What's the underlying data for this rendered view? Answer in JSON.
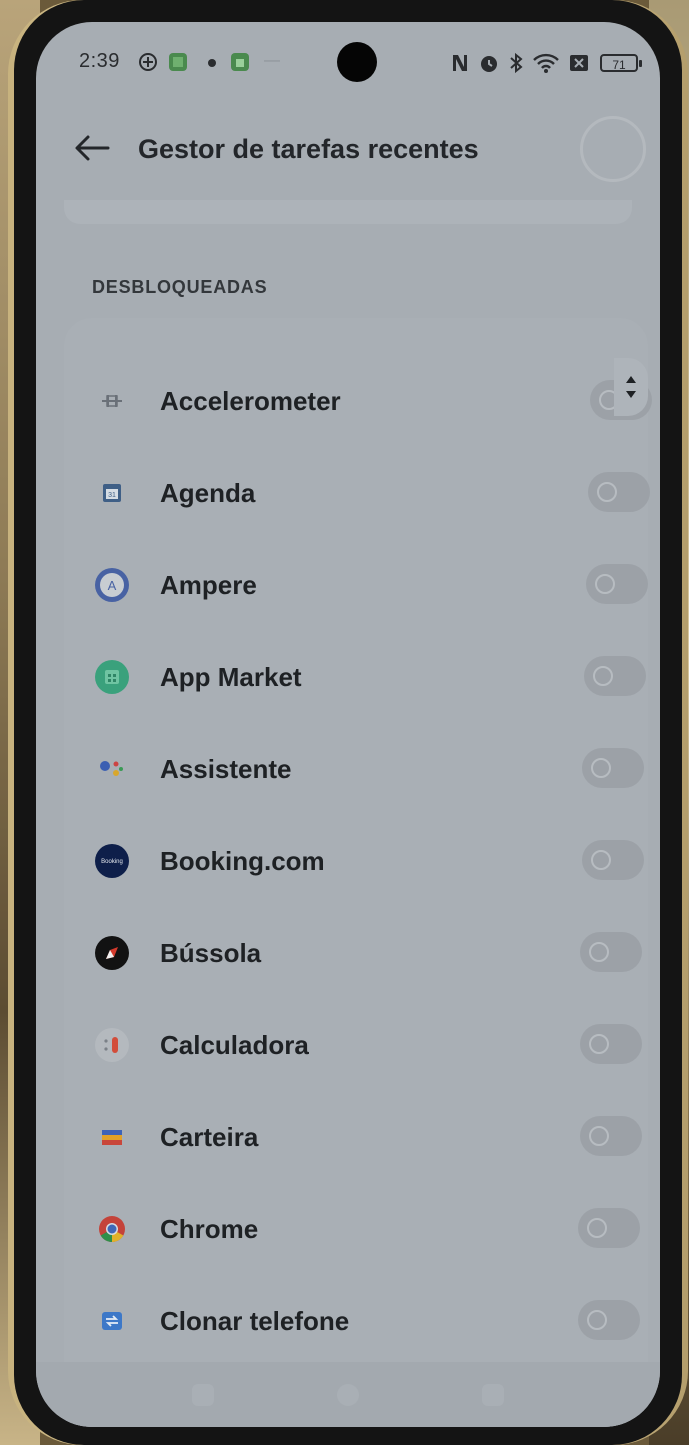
{
  "status_bar": {
    "time": "2:39",
    "battery": "71"
  },
  "header": {
    "title": "Gestor de tarefas recentes"
  },
  "section": {
    "label": "DESBLOQUEADAS"
  },
  "apps": [
    {
      "label": "Accelerometer",
      "icon": "accelerometer-icon",
      "enabled": false
    },
    {
      "label": "Agenda",
      "icon": "calendar-icon",
      "enabled": false
    },
    {
      "label": "Ampere",
      "icon": "ampere-icon",
      "enabled": false
    },
    {
      "label": "App Market",
      "icon": "app-market-icon",
      "enabled": false
    },
    {
      "label": "Assistente",
      "icon": "assistant-icon",
      "enabled": false
    },
    {
      "label": "Booking.com",
      "icon": "booking-icon",
      "enabled": false
    },
    {
      "label": "Bússola",
      "icon": "compass-icon",
      "enabled": false
    },
    {
      "label": "Calculadora",
      "icon": "calculator-icon",
      "enabled": false
    },
    {
      "label": "Carteira",
      "icon": "wallet-icon",
      "enabled": false
    },
    {
      "label": "Chrome",
      "icon": "chrome-icon",
      "enabled": false
    },
    {
      "label": "Clonar telefone",
      "icon": "clone-phone-icon",
      "enabled": false
    }
  ],
  "colors": {
    "screen_bg": "#a7adb3",
    "text": "#1e2124",
    "toggle_off": "#9ca1a7"
  }
}
